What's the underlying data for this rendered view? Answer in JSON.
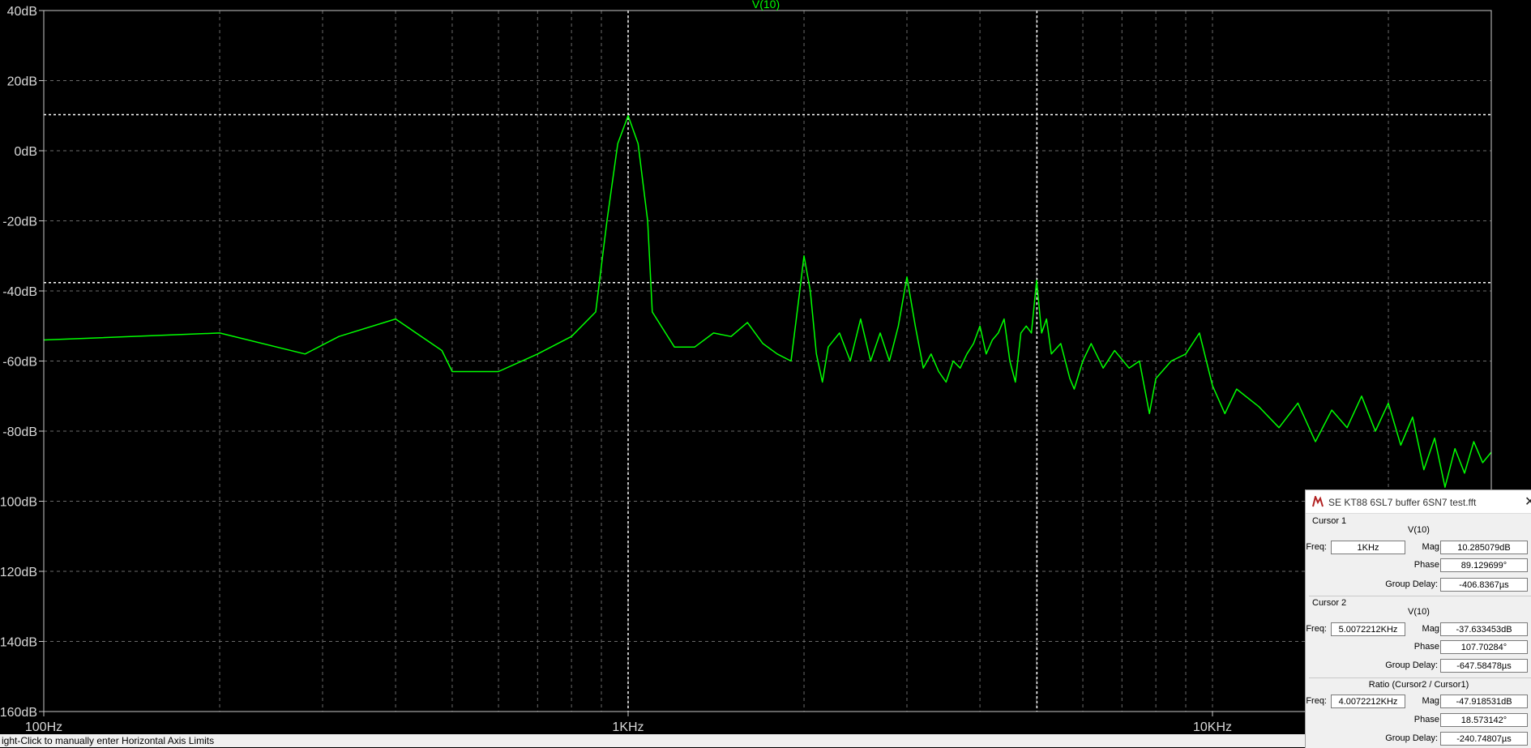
{
  "trace_title": "V(10)",
  "chart_data": {
    "type": "line",
    "x_scale": "log",
    "xlim": [
      100,
      30000
    ],
    "ylim": [
      -160,
      40
    ],
    "y_ticks": [
      {
        "value": 40,
        "label": "40dB"
      },
      {
        "value": 20,
        "label": "20dB"
      },
      {
        "value": 0,
        "label": "0dB"
      },
      {
        "value": -20,
        "label": "-20dB"
      },
      {
        "value": -40,
        "label": "-40dB"
      },
      {
        "value": -60,
        "label": "-60dB"
      },
      {
        "value": -80,
        "label": "-80dB"
      },
      {
        "value": -100,
        "label": "-100dB"
      },
      {
        "value": -120,
        "label": "-120dB"
      },
      {
        "value": -140,
        "label": "-140dB"
      },
      {
        "value": -160,
        "label": "-160dB"
      }
    ],
    "x_ticks": [
      {
        "value": 100,
        "label": "100Hz"
      },
      {
        "value": 1000,
        "label": "1KHz"
      },
      {
        "value": 10000,
        "label": "10KHz"
      }
    ],
    "grid": true,
    "series": [
      {
        "name": "V(10)",
        "color": "#00ff00",
        "points": [
          [
            100,
            -54
          ],
          [
            200,
            -52
          ],
          [
            280,
            -58
          ],
          [
            320,
            -53
          ],
          [
            400,
            -48
          ],
          [
            480,
            -57
          ],
          [
            500,
            -63
          ],
          [
            600,
            -63
          ],
          [
            700,
            -58
          ],
          [
            800,
            -53
          ],
          [
            880,
            -46
          ],
          [
            920,
            -20
          ],
          [
            960,
            2
          ],
          [
            1000,
            10
          ],
          [
            1040,
            2
          ],
          [
            1080,
            -20
          ],
          [
            1100,
            -46
          ],
          [
            1200,
            -56
          ],
          [
            1300,
            -56
          ],
          [
            1400,
            -52
          ],
          [
            1500,
            -53
          ],
          [
            1600,
            -49
          ],
          [
            1700,
            -55
          ],
          [
            1800,
            -58
          ],
          [
            1900,
            -60
          ],
          [
            1950,
            -45
          ],
          [
            2000,
            -30
          ],
          [
            2050,
            -40
          ],
          [
            2100,
            -58
          ],
          [
            2150,
            -66
          ],
          [
            2200,
            -56
          ],
          [
            2300,
            -52
          ],
          [
            2400,
            -60
          ],
          [
            2500,
            -48
          ],
          [
            2600,
            -60
          ],
          [
            2700,
            -52
          ],
          [
            2800,
            -60
          ],
          [
            2900,
            -50
          ],
          [
            3000,
            -36
          ],
          [
            3100,
            -50
          ],
          [
            3200,
            -62
          ],
          [
            3300,
            -58
          ],
          [
            3400,
            -63
          ],
          [
            3500,
            -66
          ],
          [
            3600,
            -60
          ],
          [
            3700,
            -62
          ],
          [
            3800,
            -58
          ],
          [
            3900,
            -55
          ],
          [
            4000,
            -50
          ],
          [
            4100,
            -58
          ],
          [
            4200,
            -54
          ],
          [
            4300,
            -52
          ],
          [
            4400,
            -48
          ],
          [
            4500,
            -60
          ],
          [
            4600,
            -66
          ],
          [
            4700,
            -52
          ],
          [
            4800,
            -50
          ],
          [
            4900,
            -52
          ],
          [
            5000,
            -37
          ],
          [
            5100,
            -52
          ],
          [
            5200,
            -48
          ],
          [
            5300,
            -58
          ],
          [
            5500,
            -55
          ],
          [
            5700,
            -65
          ],
          [
            5800,
            -68
          ],
          [
            6000,
            -60
          ],
          [
            6200,
            -55
          ],
          [
            6500,
            -62
          ],
          [
            6800,
            -57
          ],
          [
            7200,
            -62
          ],
          [
            7500,
            -60
          ],
          [
            7800,
            -75
          ],
          [
            8000,
            -65
          ],
          [
            8500,
            -60
          ],
          [
            9000,
            -58
          ],
          [
            9500,
            -52
          ],
          [
            10000,
            -67
          ],
          [
            10500,
            -75
          ],
          [
            11000,
            -68
          ],
          [
            12000,
            -73
          ],
          [
            13000,
            -79
          ],
          [
            14000,
            -72
          ],
          [
            15000,
            -83
          ],
          [
            16000,
            -74
          ],
          [
            17000,
            -79
          ],
          [
            18000,
            -70
          ],
          [
            19000,
            -80
          ],
          [
            20000,
            -72
          ],
          [
            21000,
            -84
          ],
          [
            22000,
            -76
          ],
          [
            23000,
            -91
          ],
          [
            24000,
            -82
          ],
          [
            25000,
            -96
          ],
          [
            26000,
            -85
          ],
          [
            27000,
            -92
          ],
          [
            28000,
            -83
          ],
          [
            29000,
            -89
          ],
          [
            30000,
            -86
          ]
        ]
      }
    ],
    "cursors": [
      {
        "name": "Cursor 1",
        "x": 1000,
        "y": 10.285079
      },
      {
        "name": "Cursor 2",
        "x": 5007.2212,
        "y": -37.633453
      }
    ]
  },
  "status_bar": "ight-Click to manually enter Horizontal Axis Limits",
  "cursor_panel": {
    "title": "SE KT88 6SL7 buffer 6SN7 test.fft",
    "close_glyph": "✕",
    "cursor1": {
      "header": "Cursor 1",
      "signal": "V(10)",
      "freq_label": "Freq:",
      "freq": "1KHz",
      "mag_label": "Mag:",
      "mag": "10.285079dB",
      "phase_label": "Phase:",
      "phase": "89.129699°",
      "gd_label": "Group Delay:",
      "gd": "-406.8367µs"
    },
    "cursor2": {
      "header": "Cursor 2",
      "signal": "V(10)",
      "freq_label": "Freq:",
      "freq": "5.0072212KHz",
      "mag_label": "Mag:",
      "mag": "-37.633453dB",
      "phase_label": "Phase:",
      "phase": "107.70284°",
      "gd_label": "Group Delay:",
      "gd": "-647.58478µs"
    },
    "ratio": {
      "header": "Ratio (Cursor2 / Cursor1)",
      "freq_label": "Freq:",
      "freq": "4.0072212KHz",
      "mag_label": "Mag:",
      "mag": "-47.918531dB",
      "phase_label": "Phase:",
      "phase": "18.573142°",
      "gd_label": "Group Delay:",
      "gd": "-240.74807µs"
    }
  }
}
